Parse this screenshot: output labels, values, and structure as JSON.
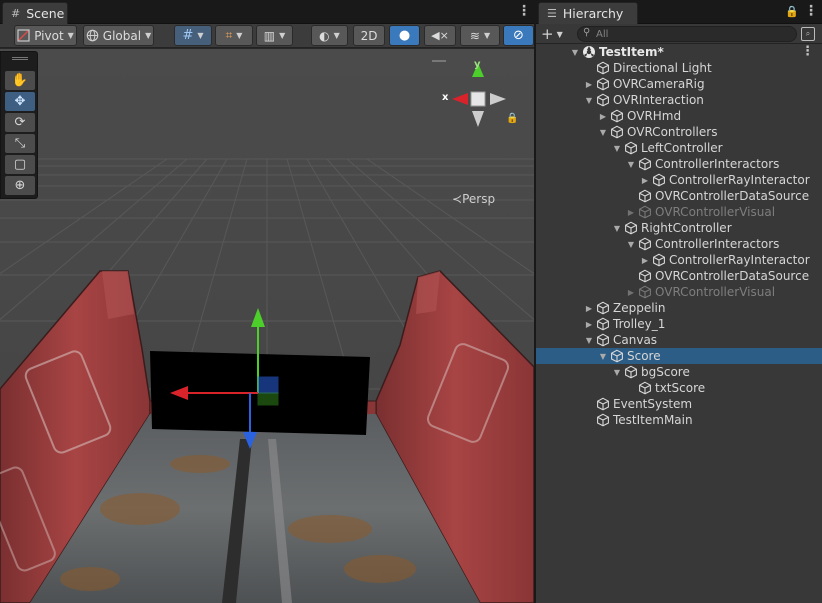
{
  "scene": {
    "tab_label": "Scene",
    "tab_icon": "#",
    "toolbar": {
      "pivot": "Pivot",
      "global": "Global",
      "mode_2d": "2D"
    },
    "persp_label": "Persp",
    "gizmo": {
      "x": "x",
      "y": "y"
    },
    "tools": [
      "hand-tool",
      "move-tool",
      "rotate-tool",
      "scale-tool",
      "rect-tool",
      "transform-tool"
    ]
  },
  "hierarchy": {
    "tab_label": "Hierarchy",
    "search_placeholder": "All",
    "add_label": "+",
    "items": [
      {
        "label": "TestItem*",
        "depth": 0,
        "arrow": "down",
        "root": true
      },
      {
        "label": "Directional Light",
        "depth": 1,
        "arrow": "none"
      },
      {
        "label": "OVRCameraRig",
        "depth": 1,
        "arrow": "right"
      },
      {
        "label": "OVRInteraction",
        "depth": 1,
        "arrow": "down"
      },
      {
        "label": "OVRHmd",
        "depth": 2,
        "arrow": "right"
      },
      {
        "label": "OVRControllers",
        "depth": 2,
        "arrow": "down"
      },
      {
        "label": "LeftController",
        "depth": 3,
        "arrow": "down"
      },
      {
        "label": "ControllerInteractors",
        "depth": 4,
        "arrow": "down"
      },
      {
        "label": "ControllerRayInteractor",
        "depth": 5,
        "arrow": "right"
      },
      {
        "label": "OVRControllerDataSource",
        "depth": 4,
        "arrow": "none"
      },
      {
        "label": "OVRControllerVisual",
        "depth": 4,
        "arrow": "right",
        "inactive": true
      },
      {
        "label": "RightController",
        "depth": 3,
        "arrow": "down"
      },
      {
        "label": "ControllerInteractors",
        "depth": 4,
        "arrow": "down"
      },
      {
        "label": "ControllerRayInteractor",
        "depth": 5,
        "arrow": "right"
      },
      {
        "label": "OVRControllerDataSource",
        "depth": 4,
        "arrow": "none"
      },
      {
        "label": "OVRControllerVisual",
        "depth": 4,
        "arrow": "right",
        "inactive": true
      },
      {
        "label": "Zeppelin",
        "depth": 1,
        "arrow": "right"
      },
      {
        "label": "Trolley_1",
        "depth": 1,
        "arrow": "right"
      },
      {
        "label": "Canvas",
        "depth": 1,
        "arrow": "down"
      },
      {
        "label": "Score",
        "depth": 2,
        "arrow": "down",
        "selected": true
      },
      {
        "label": "bgScore",
        "depth": 3,
        "arrow": "down"
      },
      {
        "label": "txtScore",
        "depth": 4,
        "arrow": "none"
      },
      {
        "label": "EventSystem",
        "depth": 1,
        "arrow": "none"
      },
      {
        "label": "TestItemMain",
        "depth": 1,
        "arrow": "none"
      }
    ]
  },
  "colors": {
    "selection": "#2c5d87",
    "active_button": "#3a79bb",
    "trolley_red": "#9c3a3a",
    "axis_x": "#d8232a",
    "axis_y": "#4ccf2b",
    "axis_z": "#2b62e0"
  }
}
